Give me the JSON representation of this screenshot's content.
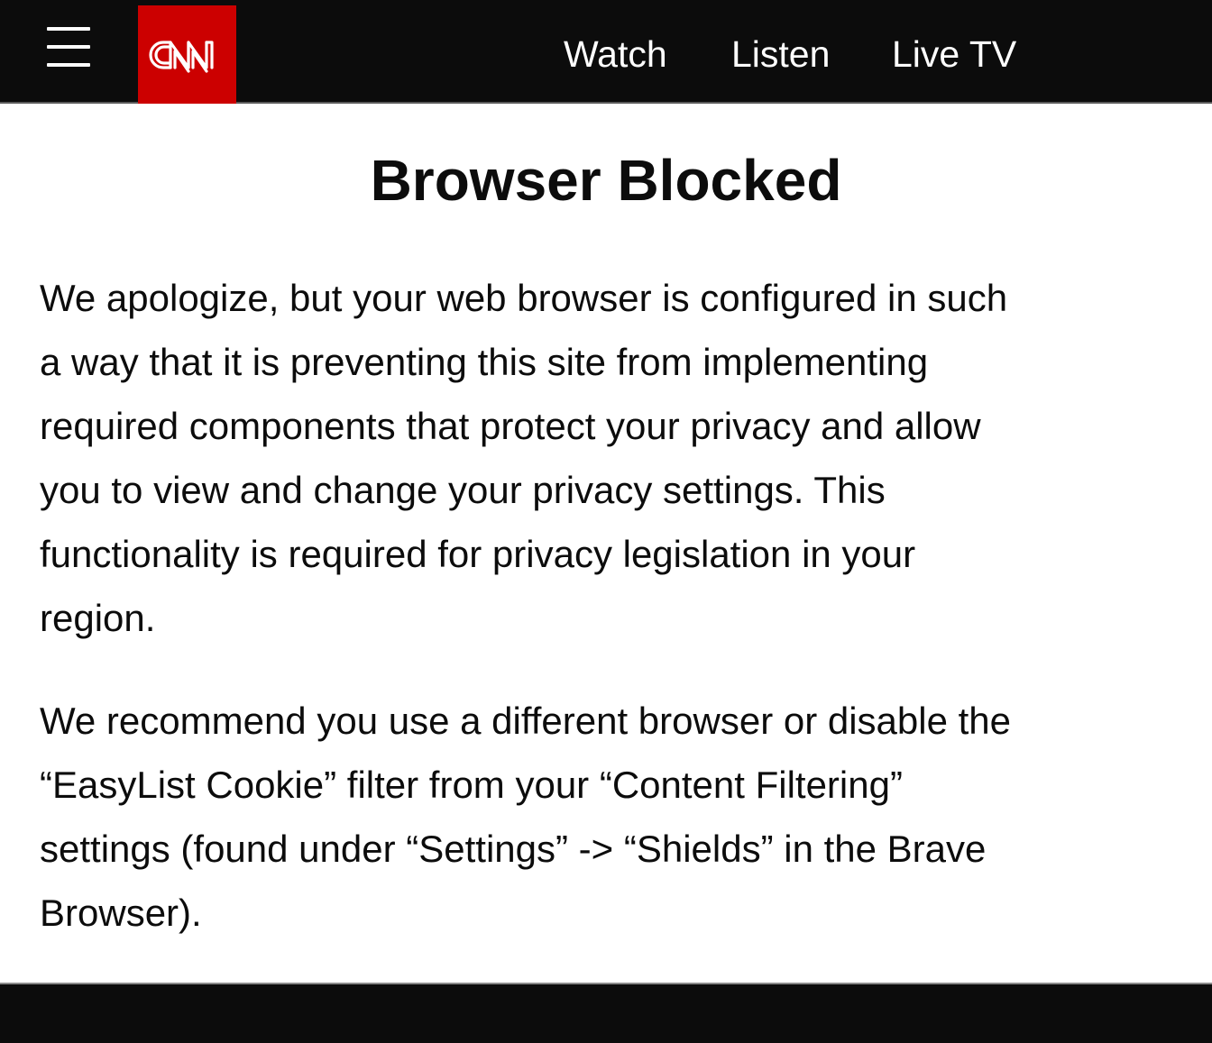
{
  "header": {
    "menu_icon": "hamburger-menu-icon",
    "logo_text": "CNN",
    "nav": [
      {
        "label": "Watch"
      },
      {
        "label": "Listen"
      },
      {
        "label": "Live TV"
      }
    ]
  },
  "main": {
    "title": "Browser Blocked",
    "paragraphs": [
      {
        "lines": [
          "We apologize, but your web browser is configured in such",
          "a way that it is preventing this site from implementing",
          "required components that protect your privacy and allow",
          "you to view and change your privacy settings. This",
          "functionality is required for privacy legislation in your",
          "region."
        ]
      },
      {
        "lines": [
          "We recommend you use a different browser or disable the",
          "“EasyList Cookie” filter from your “Content Filtering”",
          "settings (found under “Settings” -> “Shields” in the Brave",
          "Browser)."
        ]
      }
    ]
  },
  "colors": {
    "header_bg": "#0c0c0c",
    "brand_red": "#cc0000",
    "text": "#0c0c0c",
    "nav_text": "#ffffff"
  }
}
